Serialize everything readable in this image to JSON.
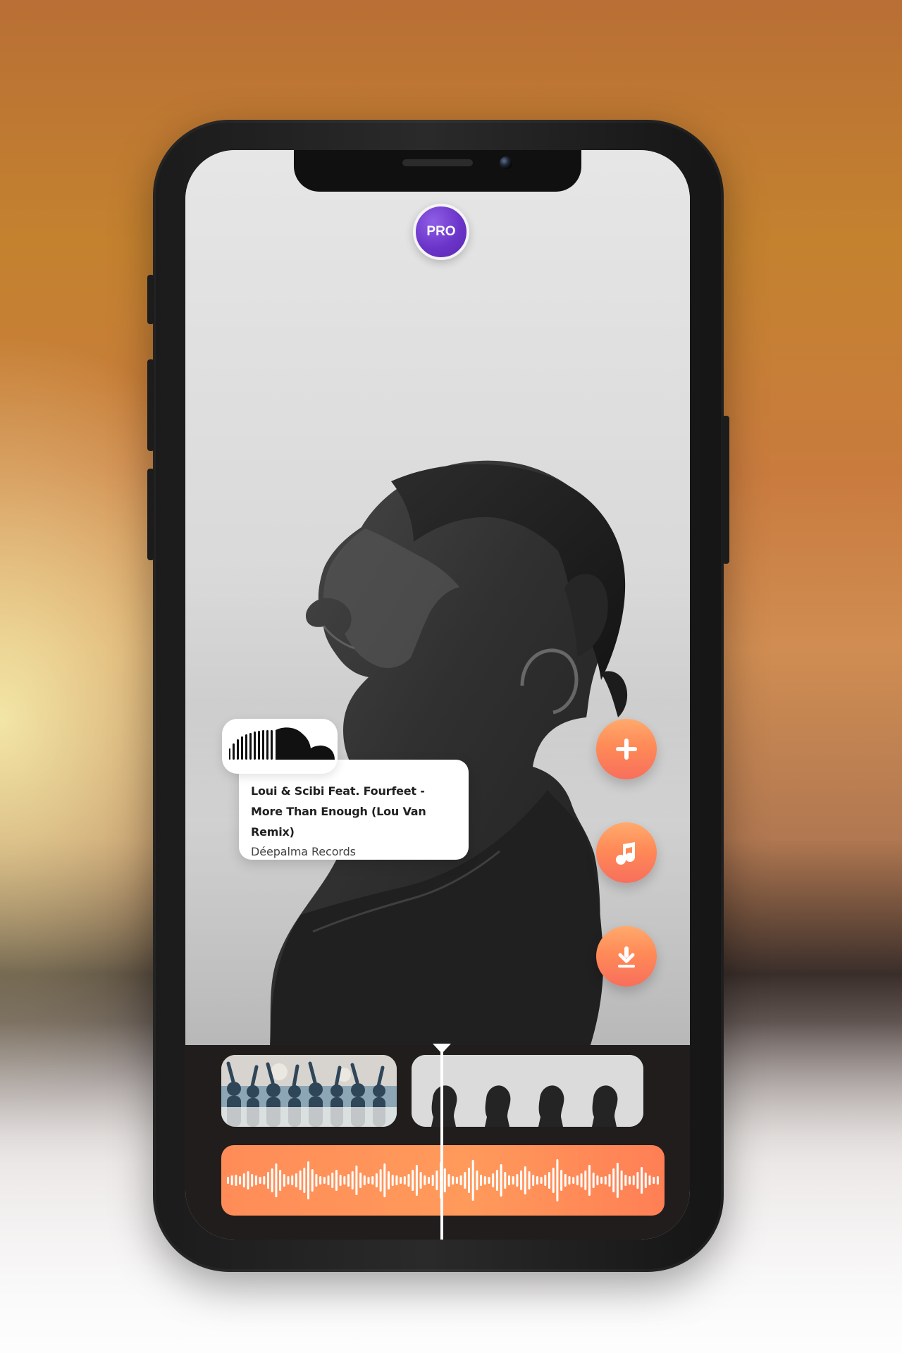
{
  "app": {
    "pro_badge_label": "PRO"
  },
  "track_card": {
    "title": "Loui & Scibi Feat. Fourfeet - More Than Enough (Lou Van Remix)",
    "label": "Déepalma Records",
    "service_icon": "soundcloud-icon"
  },
  "actions": {
    "add_icon": "plus-icon",
    "music_icon": "music-note-icon",
    "download_icon": "download-icon"
  },
  "timeline": {
    "clip_one_icon": "crowd-thumbnail-icon",
    "clip_two_icon": "portrait-thumbnail-icon",
    "audio_icon": "waveform-icon"
  },
  "colors": {
    "accent_orange": "#ff8a57",
    "accent_purple": "#6b34c9",
    "timeline_bg": "#211d1c",
    "screen_bg": "#e8e8e8"
  }
}
